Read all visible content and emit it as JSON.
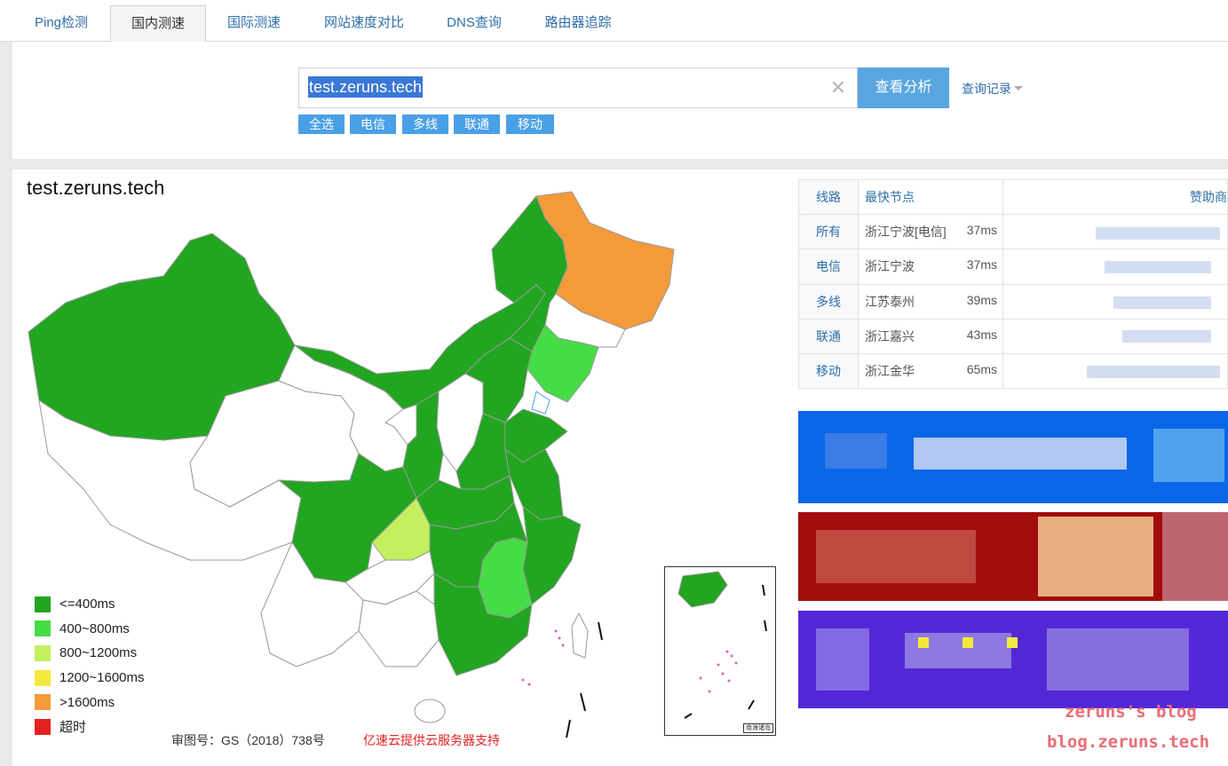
{
  "tabs": [
    {
      "label": "Ping检测",
      "active": false
    },
    {
      "label": "国内测速",
      "active": true
    },
    {
      "label": "国际测速",
      "active": false
    },
    {
      "label": "网站速度对比",
      "active": false
    },
    {
      "label": "DNS查询",
      "active": false
    },
    {
      "label": "路由器追踪",
      "active": false
    }
  ],
  "search": {
    "value": "test.zeruns.tech",
    "clear_icon": "close-icon",
    "analyze_label": "查看分析",
    "history_label": "查询记录"
  },
  "isp_filters": [
    "全选",
    "电信",
    "多线",
    "联通",
    "移动"
  ],
  "map": {
    "title": "test.zeruns.tech",
    "legend": [
      {
        "label": "<=400ms",
        "color": "#22a520"
      },
      {
        "label": "400~800ms",
        "color": "#45dc45"
      },
      {
        "label": "800~1200ms",
        "color": "#c4f060"
      },
      {
        "label": "1200~1600ms",
        "color": "#f5e83c"
      },
      {
        "label": ">1600ms",
        "color": "#f49a3a"
      },
      {
        "label": "超时",
        "color": "#e52020"
      }
    ],
    "approval": "审图号：GS（2018）738号",
    "support": "亿速云提供云服务器支持",
    "inset_label": "南海诸岛"
  },
  "route_table": {
    "headers": {
      "line": "线路",
      "node": "最快节点",
      "sponsor": "赞助商"
    },
    "rows": [
      {
        "line": "所有",
        "node": "浙江宁波[电信]",
        "ms": "37ms"
      },
      {
        "line": "电信",
        "node": "浙江宁波",
        "ms": "37ms"
      },
      {
        "line": "多线",
        "node": "江苏泰州",
        "ms": "39ms"
      },
      {
        "line": "联通",
        "node": "浙江嘉兴",
        "ms": "43ms"
      },
      {
        "line": "移动",
        "node": "浙江金华",
        "ms": "65ms"
      }
    ]
  },
  "watermark": {
    "line1": "zeruns's blog",
    "line2": "blog.zeruns.tech"
  }
}
